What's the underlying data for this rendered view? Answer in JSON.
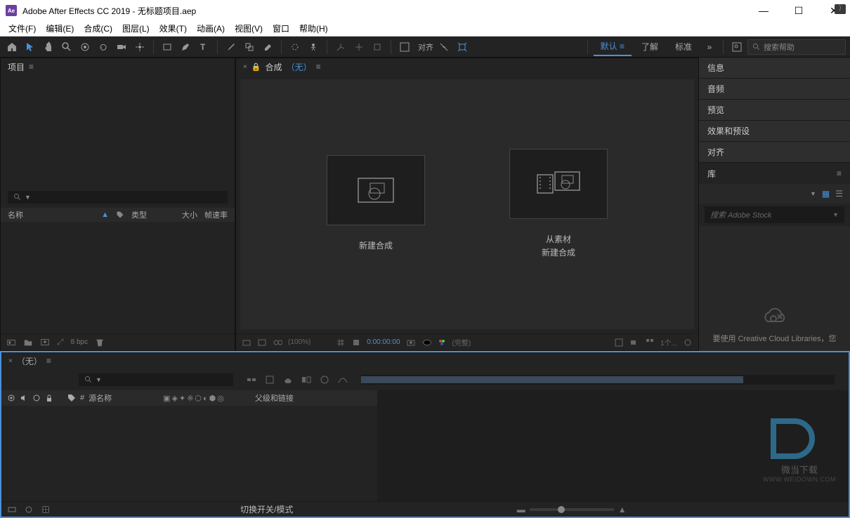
{
  "titlebar": {
    "app_abbrev": "Ae",
    "title": "Adobe After Effects CC 2019 - 无标题项目.aep"
  },
  "menubar": {
    "items": [
      "文件(F)",
      "编辑(E)",
      "合成(C)",
      "图层(L)",
      "效果(T)",
      "动画(A)",
      "视图(V)",
      "窗口",
      "帮助(H)"
    ]
  },
  "toolbar": {
    "align_label": "对齐",
    "workspaces": [
      "默认",
      "了解",
      "标准"
    ],
    "search_placeholder": "搜索帮助"
  },
  "project": {
    "tab_label": "项目",
    "headers": {
      "name": "名称",
      "type": "类型",
      "size": "大小",
      "fps": "帧速率"
    },
    "footer": {
      "bpc": "8 bpc"
    }
  },
  "comp": {
    "tab_label": "合成",
    "none_label": "（无）",
    "tile1": "新建合成",
    "tile2_line1": "从素材",
    "tile2_line2": "新建合成",
    "footer": {
      "pct": "(100%)",
      "timecode": "0:00:00:00",
      "full": "(完整)"
    }
  },
  "right_panels": {
    "items": [
      "信息",
      "音频",
      "预览",
      "效果和预设",
      "对齐"
    ],
    "lib_label": "库",
    "lib_search": "搜索 Adobe Stock",
    "lib_msg": "要使用 Creative Cloud Libraries，您"
  },
  "timeline": {
    "none_text": "（无）",
    "source_name": "源名称",
    "parent": "父级和链接",
    "switches": "切换开关/模式"
  },
  "watermark": {
    "line1": "微当下载",
    "line2": "WWW.WEIDOWN.COM"
  }
}
